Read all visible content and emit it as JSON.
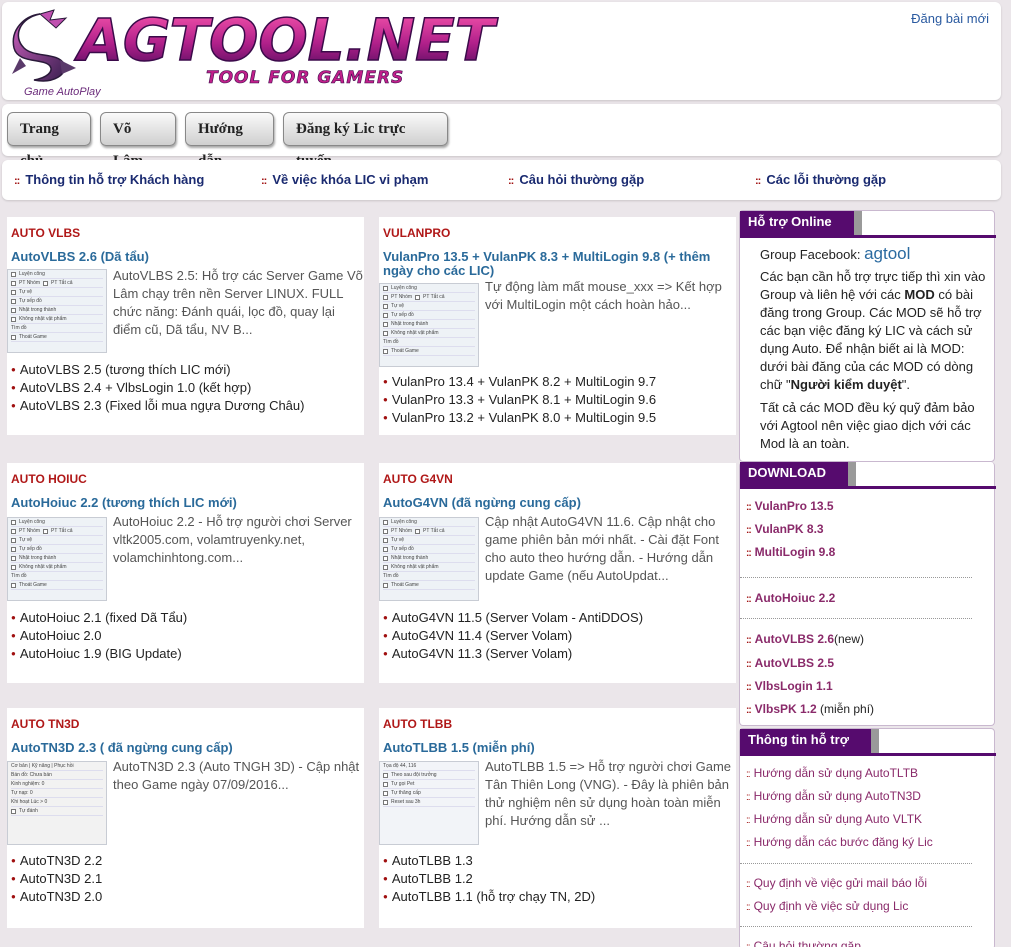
{
  "header": {
    "logo_text": "AGTOOL.NET",
    "logo_tagline": "TOOL FOR GAMERS",
    "logo_sub": "Game AutoPlay",
    "post_link": "Đăng bài mới"
  },
  "nav": {
    "items": [
      "Trang chủ",
      "Võ Lâm",
      "Hướng dẫn",
      "Đăng ký Lic trực tuyến"
    ]
  },
  "subnav": {
    "items": [
      "Thông tin hỗ trợ Khách hàng",
      "Về việc khóa LIC vi phạm",
      "Câu hỏi thường gặp",
      "Các lỗi thường gặp"
    ]
  },
  "cards": [
    {
      "tag": "AUTO VLBS",
      "title": "AutoVLBS 2.6 (Dã tẩu)",
      "desc": "  AutoVLBS 2.5: Hỗ trợ các Server Game Võ Lâm chạy trên nền Server LINUX. FULL chức năng: Đánh quái, lọc đồ, quay lại điểm cũ, Dã tẩu, NV B...",
      "list": [
        "AutoVLBS 2.5 (tương thích LIC mới)",
        "AutoVLBS 2.4 + VlbsLogin 1.0 (kết hợp)",
        "AutoVLBS 2.3 (Fixed lỗi mua ngựa Dương Châu)"
      ]
    },
    {
      "tag": "VULANPRO",
      "title": "VulanPro 13.5 + VulanPK 8.3 + MultiLogin 9.8 (+ thêm ngày cho các LIC)",
      "desc": "Tự động làm mất mouse_xxx => Kết hợp với MultiLogin một cách hoàn hảo...",
      "list": [
        "VulanPro 13.4 + VulanPK 8.2 + MultiLogin 9.7",
        "VulanPro 13.3 + VulanPK 8.1 + MultiLogin 9.6",
        "VulanPro 13.2 + VulanPK 8.0 + MultiLogin 9.5"
      ]
    },
    {
      "tag": "AUTO HOIUC",
      "title": "AutoHoiuc 2.2 (tương thích LIC mới)",
      "desc": "AutoHoiuc 2.2 - Hỗ trợ người chơi Server vltk2005.com, volamtruyenky.net, volamchinhtong.com...",
      "list": [
        "AutoHoiuc 2.1 (fixed Dã Tẩu)",
        "AutoHoiuc 2.0",
        "AutoHoiuc 1.9 (BIG Update)"
      ]
    },
    {
      "tag": "AUTO G4VN",
      "title": "AutoG4VN (đã ngừng cung cấp)",
      "desc": "Cập nhật AutoG4VN 11.6. Cập nhật cho game phiên bản mới nhất. - Cài đặt Font cho auto theo hướng dẫn. - Hướng dẫn update Game (nếu AutoUpdat...",
      "list": [
        "AutoG4VN 11.5 (Server Volam - AntiDDOS)",
        "AutoG4VN 11.4 (Server Volam)",
        "AutoG4VN 11.3 (Server Volam)"
      ]
    },
    {
      "tag": "AUTO TN3D",
      "title": "AutoTN3D 2.3 ( đã ngừng cung cấp)",
      "desc": "AutoTN3D 2.3 (Auto TNGH 3D) - Cập nhật theo Game ngày 07/09/2016...",
      "list": [
        "AutoTN3D 2.2",
        "AutoTN3D 2.1",
        "AutoTN3D 2.0"
      ]
    },
    {
      "tag": "AUTO TLBB",
      "title": "AutoTLBB 1.5 (miễn phí)",
      "desc": "AutoTLBB 1.5 => Hỗ trợ người chơi Game Tân Thiên Long (VNG). - Đây là phiên bản thử nghiệm nên sử dụng hoàn toàn miễn phí.  Hướng dẫn sử ...",
      "list": [
        "AutoTLBB 1.3",
        "AutoTLBB 1.2",
        "AutoTLBB 1.1 (hỗ trợ chạy TN, 2D)"
      ]
    }
  ],
  "sidebar": {
    "support": {
      "tab": "Hỗ trợ Online",
      "group_label": "Group Facebook:",
      "group_link": "agtool",
      "p1_a": "Các bạn cần hỗ trợ trực tiếp thì xin vào Group và liên hệ với các ",
      "p1_mod": "MOD",
      "p1_b": " có bài đăng trong Group. Các  MOD sẽ hỗ trợ các bạn việc đăng ký LIC và cách sử dụng Auto. Để nhận biết ai là MOD: dưới bài đăng của các MOD có dòng chữ \"",
      "p1_strong": "Người kiểm duyệt",
      "p1_c": "\".",
      "p2": "Tất cả các MOD đều ký quỹ đảm bảo với Agtool nên việc giao dịch với các Mod là an toàn."
    },
    "download": {
      "tab": "DOWNLOAD",
      "items": [
        {
          "label": "VulanPro 13.5",
          "suffix": ""
        },
        {
          "label": "VulanPK 8.3",
          "suffix": ""
        },
        {
          "label": "MultiLogin 9.8",
          "suffix": ""
        },
        {
          "label": "AutoHoiuc 2.2",
          "suffix": ""
        },
        {
          "label": "AutoVLBS 2.6",
          "suffix": "(new)"
        },
        {
          "label": "AutoVLBS 2.5",
          "suffix": ""
        },
        {
          "label": "VlbsLogin 1.1",
          "suffix": ""
        },
        {
          "label": "VlbsPK 1.2",
          "suffix": " (miễn phí)"
        }
      ]
    },
    "info": {
      "tab": "Thông tin hỗ trợ",
      "items": [
        "Hướng dẫn sử dụng AutoTLTB",
        "Hướng dẫn sử dụng AutoTN3D",
        "Hướng dẫn sử dụng Auto VLTK",
        "Hướng dẫn các bước đăng ký Lic",
        "Quy định về việc gửi mail báo lỗi",
        "Quy định về việc sử dụng Lic",
        "Câu hỏi thường gặp"
      ]
    }
  }
}
